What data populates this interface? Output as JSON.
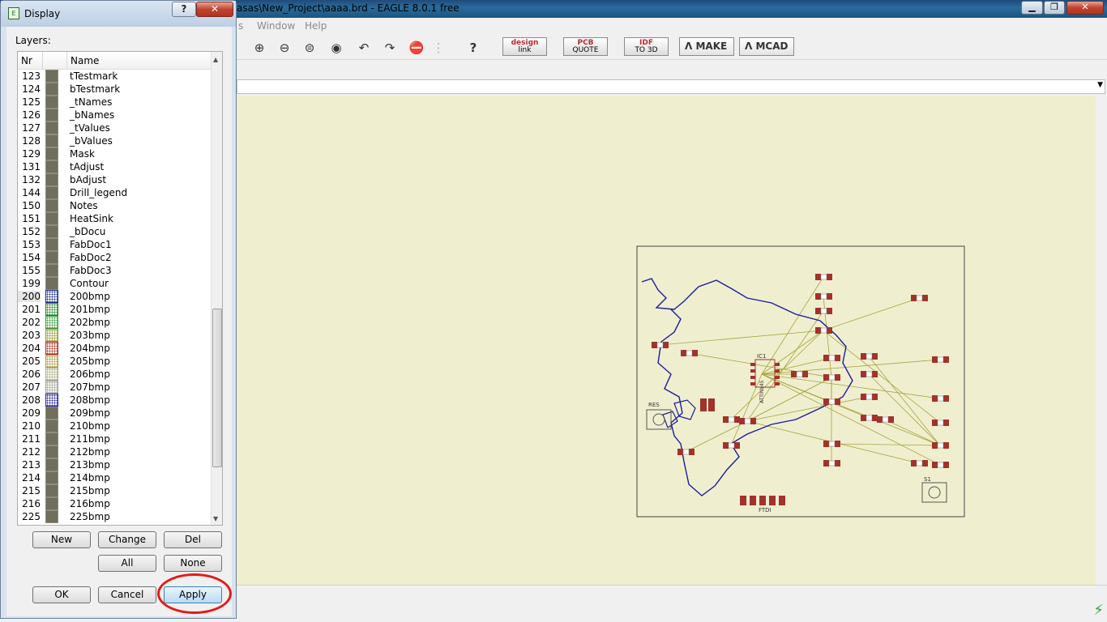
{
  "window": {
    "title": "asas\\New_Project\\aaaa.brd - EAGLE 8.0.1 free",
    "minimize": "▁",
    "maximize": "❐",
    "close": "✕"
  },
  "menu": {
    "items": [
      "s",
      "Window",
      "Help"
    ]
  },
  "toolbar": {
    "designlink_top": "design",
    "designlink_bottom": "link",
    "pcbquote_top": "PCB",
    "pcbquote_bottom": "QUOTE",
    "idf_top": "IDF",
    "idf_bottom": "TO 3D",
    "make_label": "MAKE",
    "mcad_label": "MCAD",
    "help_icon": "?"
  },
  "dialog": {
    "title": "Display",
    "help_button": "?",
    "close_button": "✕",
    "layers_label": "Layers:",
    "columns": {
      "nr": "Nr",
      "name": "Name"
    },
    "layers": [
      {
        "nr": "123",
        "name": "tTestmark"
      },
      {
        "nr": "124",
        "name": "bTestmark"
      },
      {
        "nr": "125",
        "name": "_tNames"
      },
      {
        "nr": "126",
        "name": "_bNames"
      },
      {
        "nr": "127",
        "name": "_tValues"
      },
      {
        "nr": "128",
        "name": "_bValues"
      },
      {
        "nr": "129",
        "name": "Mask"
      },
      {
        "nr": "131",
        "name": "tAdjust"
      },
      {
        "nr": "132",
        "name": "bAdjust"
      },
      {
        "nr": "144",
        "name": "Drill_legend"
      },
      {
        "nr": "150",
        "name": "Notes"
      },
      {
        "nr": "151",
        "name": "HeatSink"
      },
      {
        "nr": "152",
        "name": "_bDocu"
      },
      {
        "nr": "153",
        "name": "FabDoc1"
      },
      {
        "nr": "154",
        "name": "FabDoc2"
      },
      {
        "nr": "155",
        "name": "FabDoc3"
      },
      {
        "nr": "199",
        "name": "Contour"
      },
      {
        "nr": "200",
        "name": "200bmp",
        "color": "#1a2f9a"
      },
      {
        "nr": "201",
        "name": "201bmp",
        "color": "#1a8a2a"
      },
      {
        "nr": "202",
        "name": "202bmp",
        "color": "#3aa04a"
      },
      {
        "nr": "203",
        "name": "203bmp",
        "color": "#9a9a30"
      },
      {
        "nr": "204",
        "name": "204bmp",
        "color": "#b03030"
      },
      {
        "nr": "205",
        "name": "205bmp",
        "color": "#b0a050"
      },
      {
        "nr": "206",
        "name": "206bmp",
        "color": "#b0b090"
      },
      {
        "nr": "207",
        "name": "207bmp",
        "color": "#a0a0a0"
      },
      {
        "nr": "208",
        "name": "208bmp",
        "color": "#2a2ab0"
      },
      {
        "nr": "209",
        "name": "209bmp"
      },
      {
        "nr": "210",
        "name": "210bmp"
      },
      {
        "nr": "211",
        "name": "211bmp"
      },
      {
        "nr": "212",
        "name": "212bmp"
      },
      {
        "nr": "213",
        "name": "213bmp"
      },
      {
        "nr": "214",
        "name": "214bmp"
      },
      {
        "nr": "215",
        "name": "215bmp"
      },
      {
        "nr": "216",
        "name": "216bmp"
      },
      {
        "nr": "225",
        "name": "225bmp"
      }
    ],
    "buttons": {
      "new": "New",
      "change": "Change",
      "del": "Del",
      "all": "All",
      "none": "None",
      "ok": "OK",
      "cancel": "Cancel",
      "apply": "Apply"
    }
  },
  "board": {
    "labels": {
      "ic": "IC1",
      "ic_value": "ATTINY45",
      "connector": "FTDI",
      "switch": "S1",
      "resonator": "RES"
    }
  },
  "colors": {
    "canvas": "#efefd0",
    "airwire": "#a8a33a",
    "pad": "#a3322b",
    "outline": "#1c1c9c",
    "highlight": "#e11b1b"
  }
}
